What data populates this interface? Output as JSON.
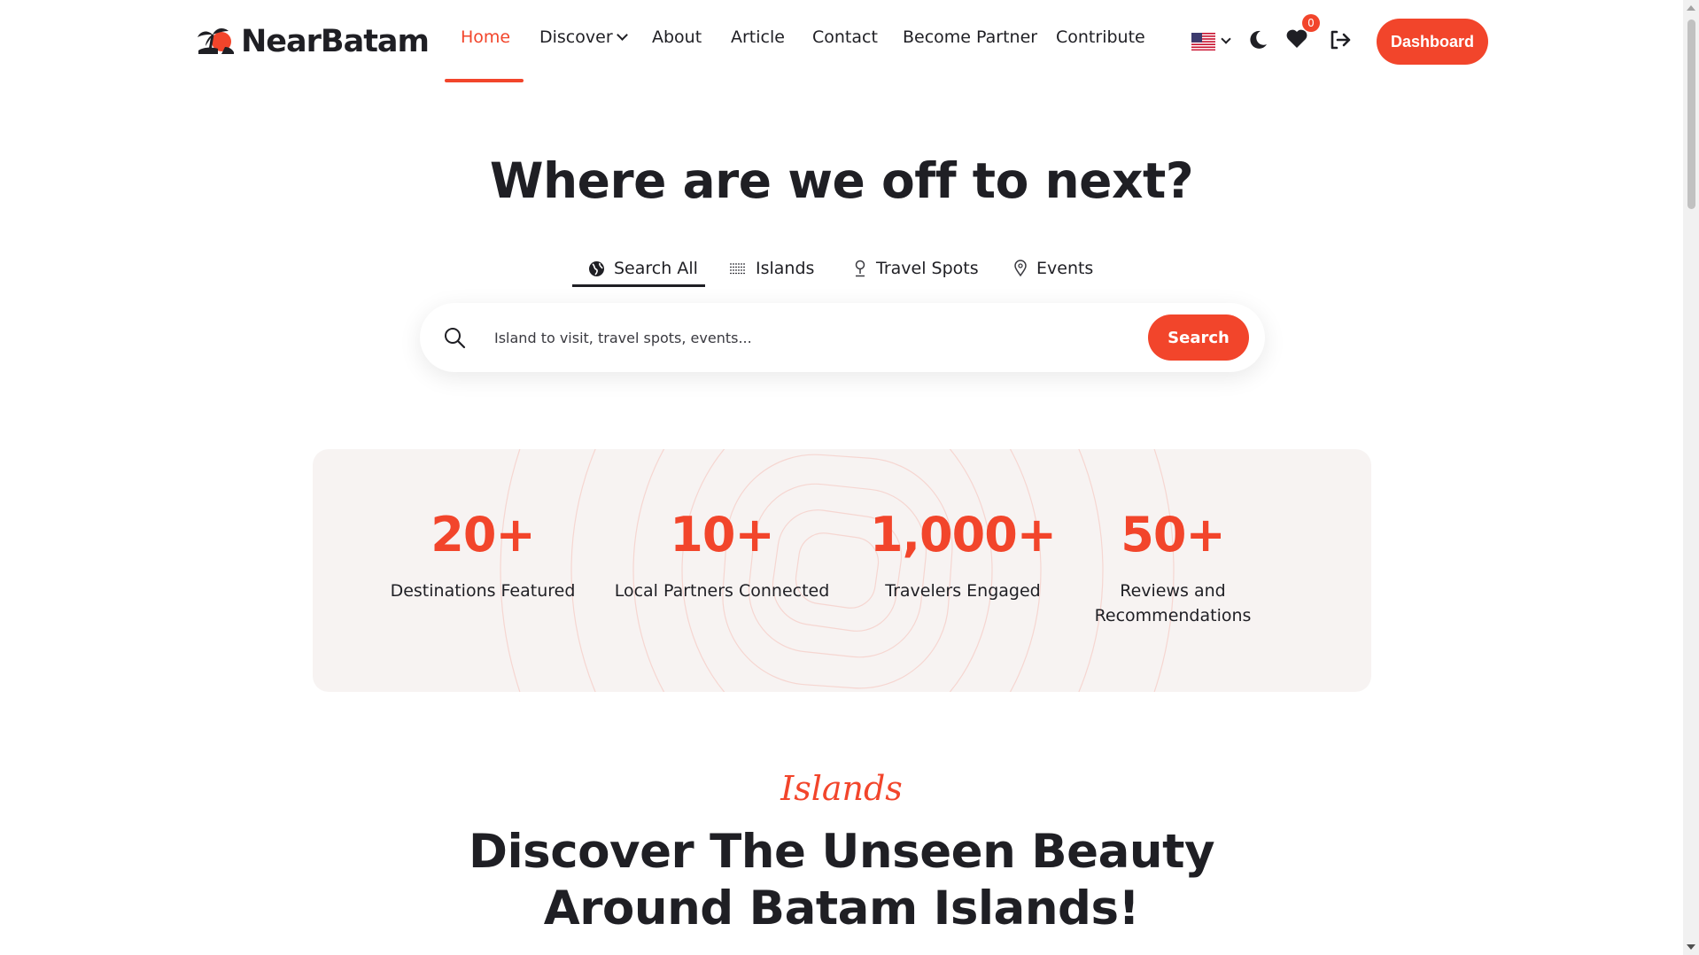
{
  "brand": {
    "name": "NearBatam"
  },
  "nav": {
    "items": [
      {
        "label": "Home",
        "active": true
      },
      {
        "label": "Discover",
        "dropdown": true
      },
      {
        "label": "About"
      },
      {
        "label": "Article"
      },
      {
        "label": "Contact"
      },
      {
        "label": "Become Partner"
      },
      {
        "label": "Contribute"
      }
    ]
  },
  "toolbar": {
    "language_flag": "us-flag-icon",
    "theme_icon": "moon-icon",
    "wishlist_icon": "heart-icon",
    "wishlist_count": "0",
    "logout_icon": "logout-icon",
    "dashboard_label": "Dashboard"
  },
  "hero": {
    "title": "Where are we off to next?",
    "tabs": [
      {
        "label": "Search All",
        "icon": "globe-icon",
        "active": true
      },
      {
        "label": "Islands",
        "icon": "waves-icon"
      },
      {
        "label": "Travel Spots",
        "icon": "pin-icon"
      },
      {
        "label": "Events",
        "icon": "location-icon"
      }
    ],
    "search": {
      "placeholder": "Island to visit, travel spots, events...",
      "button_label": "Search"
    }
  },
  "stats": [
    {
      "value": "20+",
      "label": "Destinations Featured"
    },
    {
      "value": "10+",
      "label": "Local Partners Connected"
    },
    {
      "value": "1,000+",
      "label": "Travelers Engaged"
    },
    {
      "value": "50+",
      "label": "Reviews and Recommendations"
    }
  ],
  "section": {
    "kicker": "Islands",
    "title_line1": "Discover The Unseen Beauty",
    "title_line2": "Around Batam Islands!"
  },
  "colors": {
    "accent": "#f2452b",
    "text": "#1f1f24",
    "stats_bg": "#f7f3f2"
  }
}
